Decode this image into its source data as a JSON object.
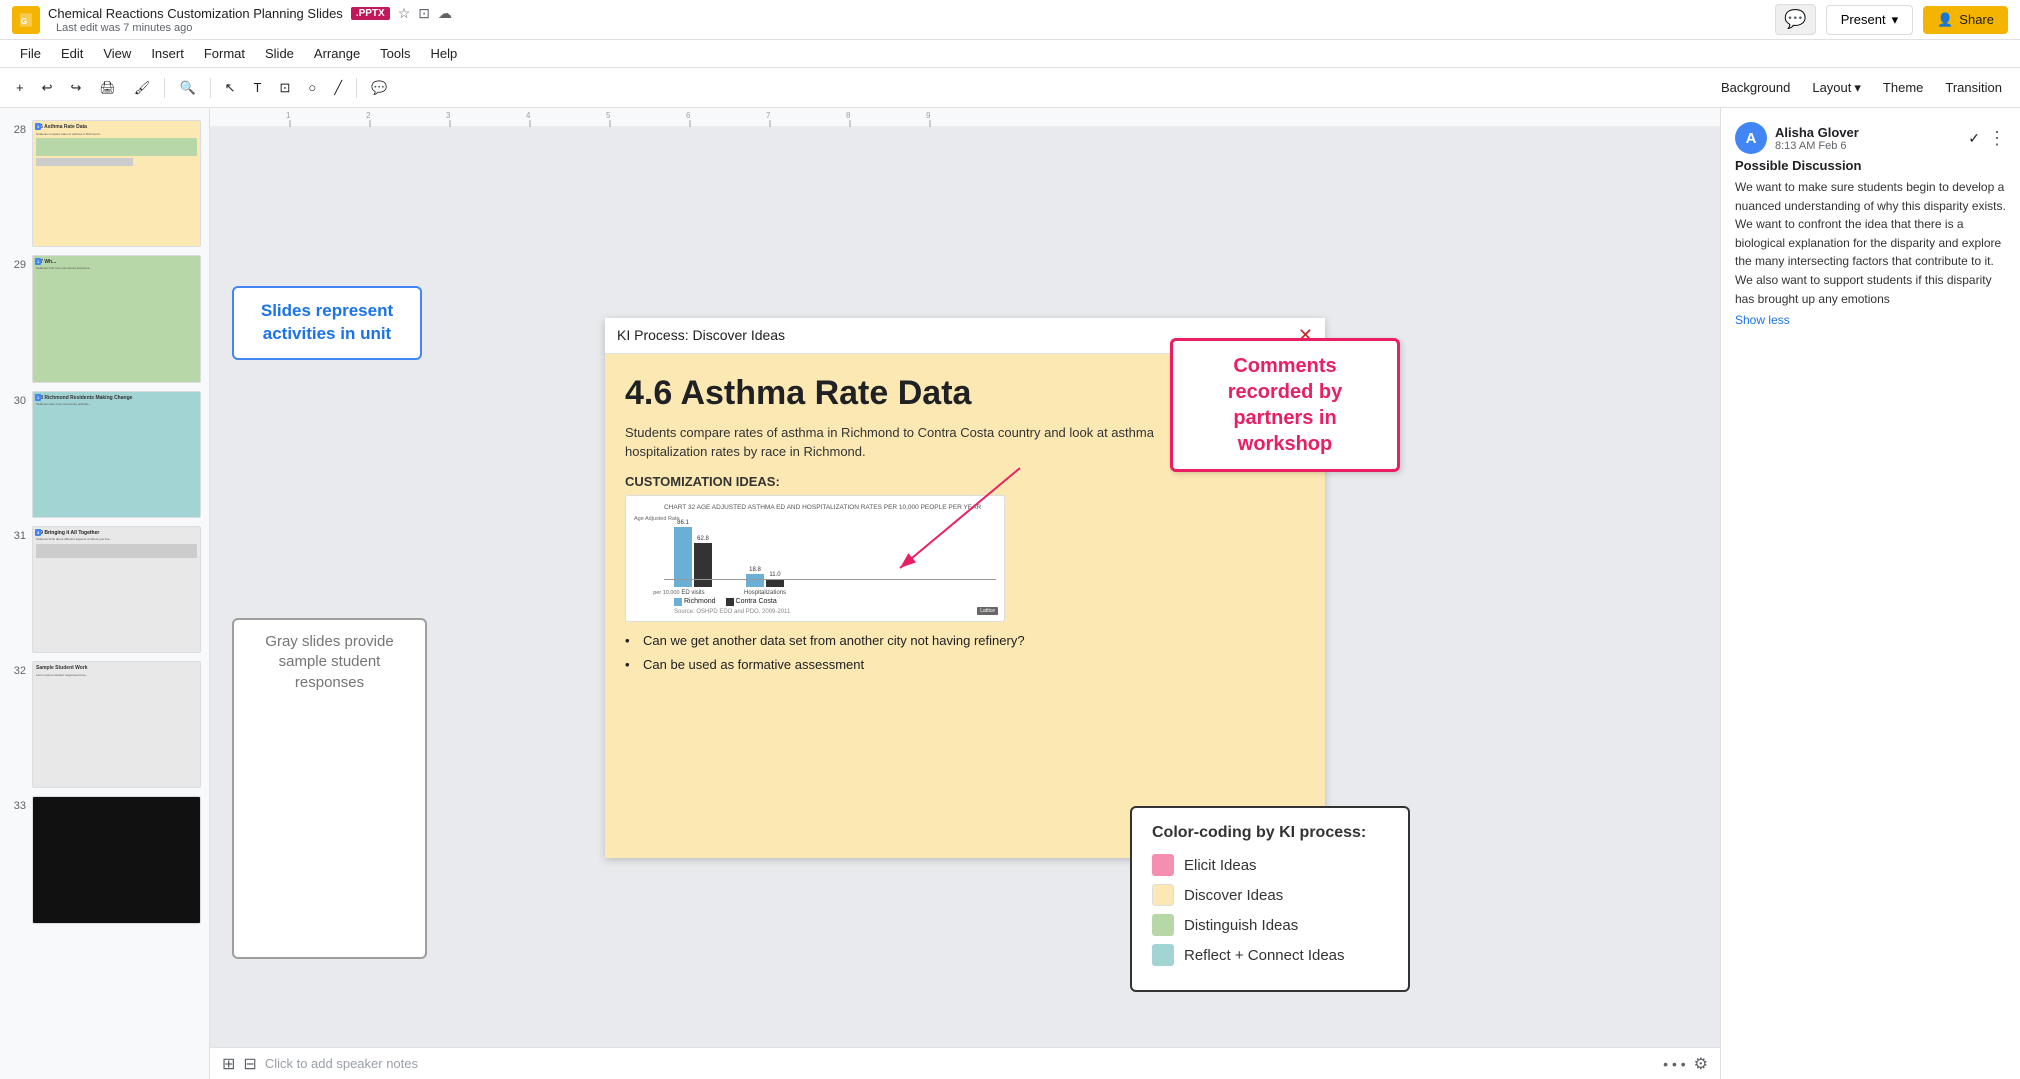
{
  "app": {
    "icon_letter": "G",
    "doc_title": "Chemical Reactions Customization Planning Slides",
    "file_type_badge": ".PPTX",
    "last_edit": "Last edit was 7 minutes ago",
    "present_label": "Present",
    "share_label": "Share"
  },
  "menubar": {
    "items": [
      "File",
      "Edit",
      "View",
      "Insert",
      "Format",
      "Slide",
      "Arrange",
      "Tools",
      "Help"
    ]
  },
  "toolbar": {
    "background_label": "Background",
    "layout_label": "Layout",
    "theme_label": "Theme",
    "transition_label": "Transition"
  },
  "slide_panel": {
    "slides": [
      {
        "num": "28",
        "type": "orange"
      },
      {
        "num": "29",
        "type": "green"
      },
      {
        "num": "30",
        "type": "teal"
      },
      {
        "num": "31",
        "type": "gray_content"
      },
      {
        "num": "32",
        "type": "gray_sample"
      },
      {
        "num": "33",
        "type": "black"
      }
    ]
  },
  "slide": {
    "header": "KI Process: Discover Ideas",
    "title": "4.6 Asthma Rate Data",
    "body_text": "Students compare rates of asthma in Richmond to Contra Costa country and look at asthma hospitalization rates by race in Richmond.",
    "customization_label": "CUSTOMIZATION IDEAS:",
    "chart": {
      "title": "Chart 32 Age Adjusted Asthma ED and Hospitalization Rates per 10,000 People Per Year",
      "source": "Source: OSHPD EDO and PDO, 2009-2011",
      "bars": [
        {
          "label": "ED visits",
          "richmond": 86.1,
          "contra_costa": 62.8
        },
        {
          "label": "Hospitalizations",
          "richmond": 18.8,
          "contra_costa": 11.0
        }
      ],
      "legend": {
        "richmond": "Richmond",
        "contra_costa": "Contra Costa"
      }
    },
    "bullets": [
      "Can we get another data set from another city not having refinery?",
      "Can be used as formative assessment"
    ]
  },
  "callouts": {
    "slides_activities": "Slides represent activities in unit",
    "gray_slides": "Gray slides provide sample student responses",
    "comments_recorded": "Comments recorded by partners in workshop"
  },
  "color_legend": {
    "title": "Color-coding by KI process:",
    "items": [
      {
        "label": "Elicit Ideas",
        "color": "pink"
      },
      {
        "label": "Discover Ideas",
        "color": "orange"
      },
      {
        "label": "Distinguish Ideas",
        "color": "green"
      },
      {
        "label": "Reflect + Connect Ideas",
        "color": "teal"
      }
    ]
  },
  "comment": {
    "author": "Alisha Glover",
    "avatar_letter": "A",
    "time": "8:13 AM Feb 6",
    "type": "Possible Discussion",
    "text": "We want to make sure students begin to develop a nuanced understanding of why this disparity exists. We want to confront the idea that there is a biological explanation for the disparity and explore the many intersecting factors that contribute to it. We also want to support students if this disparity has brought up any emotions",
    "show_less": "Show less"
  },
  "notes": {
    "placeholder": "Click to add speaker notes"
  }
}
